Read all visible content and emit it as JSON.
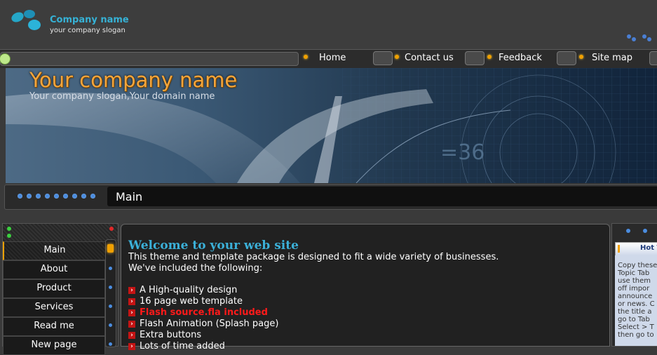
{
  "header": {
    "company_name": "Company name",
    "slogan": "your company slogan"
  },
  "nav": {
    "items": [
      {
        "label": "Home"
      },
      {
        "label": "Contact us"
      },
      {
        "label": "Feedback"
      },
      {
        "label": "Site map"
      }
    ]
  },
  "banner": {
    "title": "Your company name",
    "subtitle": "Your company slogan,Your domain name"
  },
  "strip": {
    "title": "Main"
  },
  "sidebar": {
    "items": [
      {
        "label": "Main",
        "active": true
      },
      {
        "label": "About"
      },
      {
        "label": "Product"
      },
      {
        "label": "Services"
      },
      {
        "label": "Read me"
      },
      {
        "label": "New page"
      }
    ]
  },
  "main": {
    "heading": "Welcome to your web site",
    "paragraph_line1": "This theme and template package is designed to fit a wide variety of businesses.",
    "paragraph_line2": "We've included the following:",
    "features": [
      "A High-quality design",
      "16 page web template",
      "Flash source.fla included",
      "Flash Animation (Splash page)",
      "Extra buttons",
      "Lots of time added"
    ]
  },
  "right_panel": {
    "title": "Hot Topic",
    "text": "Copy these\nTopic Tab\nuse them\noff impor\nannounce\nor news. C\nthe title a\ngo to Tab\nSelect > T\nthen go to"
  },
  "colors": {
    "accent_blue": "#36b2d6",
    "accent_orange": "#f0a000",
    "highlight_red": "#ff1a1a"
  }
}
